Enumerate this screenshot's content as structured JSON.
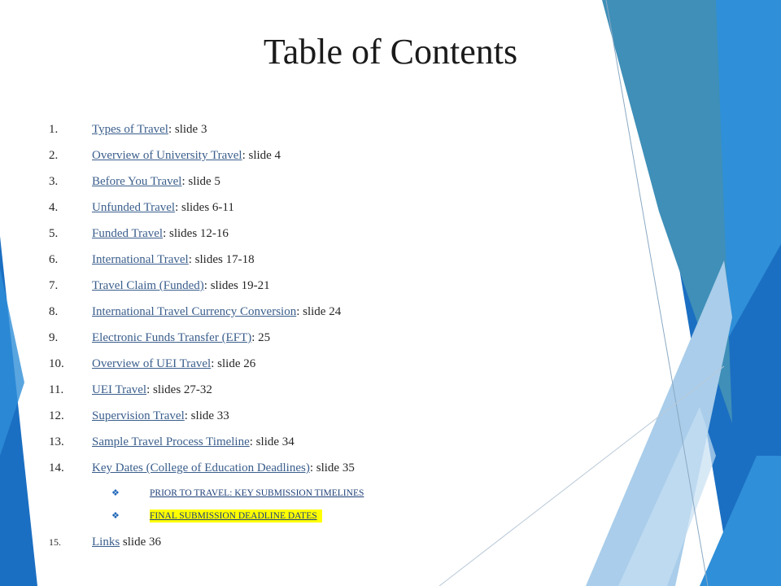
{
  "title": "Table of Contents",
  "items": [
    {
      "num": "1.",
      "link": "Types of Travel",
      "rest": ": slide 3"
    },
    {
      "num": "2.",
      "link": "Overview of University Travel",
      "rest": ": slide 4"
    },
    {
      "num": "3.",
      "link": "Before You Travel",
      "rest": ": slide 5"
    },
    {
      "num": "4.",
      "link": "Unfunded Travel",
      "rest": ": slides 6-11"
    },
    {
      "num": "5.",
      "link": "Funded Travel",
      "rest": ": slides 12-16"
    },
    {
      "num": "6.",
      "link": "International Travel",
      "rest": ": slides 17-18"
    },
    {
      "num": "7.",
      "link": "Travel Claim (Funded)",
      "rest": ": slides 19-21"
    },
    {
      "num": "8.",
      "link": "International Travel Currency Conversion",
      "rest": ": slide 24"
    },
    {
      "num": "9.",
      "link": "Electronic Funds Transfer (EFT)",
      "rest": ": 25"
    },
    {
      "num": "10.",
      "link": "Overview of UEI Travel",
      "rest": ": slide 26"
    },
    {
      "num": "11.",
      "link": "UEI Travel",
      "rest": ": slides 27-32"
    },
    {
      "num": "12.",
      "link": "Supervision Travel",
      "rest": ": slide 33"
    },
    {
      "num": "13.",
      "link": "Sample Travel Process Timeline",
      "rest": ": slide 34"
    },
    {
      "num": "14.",
      "link": "Key Dates (College of Education Deadlines)",
      "rest": ": slide 35"
    }
  ],
  "subitems": [
    {
      "bullet": "❖",
      "text": "PRIOR TO TRAVEL: KEY SUBMISSION TIMELINES",
      "highlighted": false
    },
    {
      "bullet": "❖",
      "text": "FINAL SUBMISSION DEADLINE DATES",
      "highlighted": true
    }
  ],
  "last_item": {
    "num": "15.",
    "link": "Links",
    "rest": " slide 36"
  },
  "colors": {
    "link": "#3a5e8c",
    "highlight": "#ffff00",
    "accent_dark": "#1b6fc2",
    "accent_mid": "#2f8fd8",
    "accent_teal": "#3f8fb8",
    "accent_light": "#a9cdea"
  }
}
